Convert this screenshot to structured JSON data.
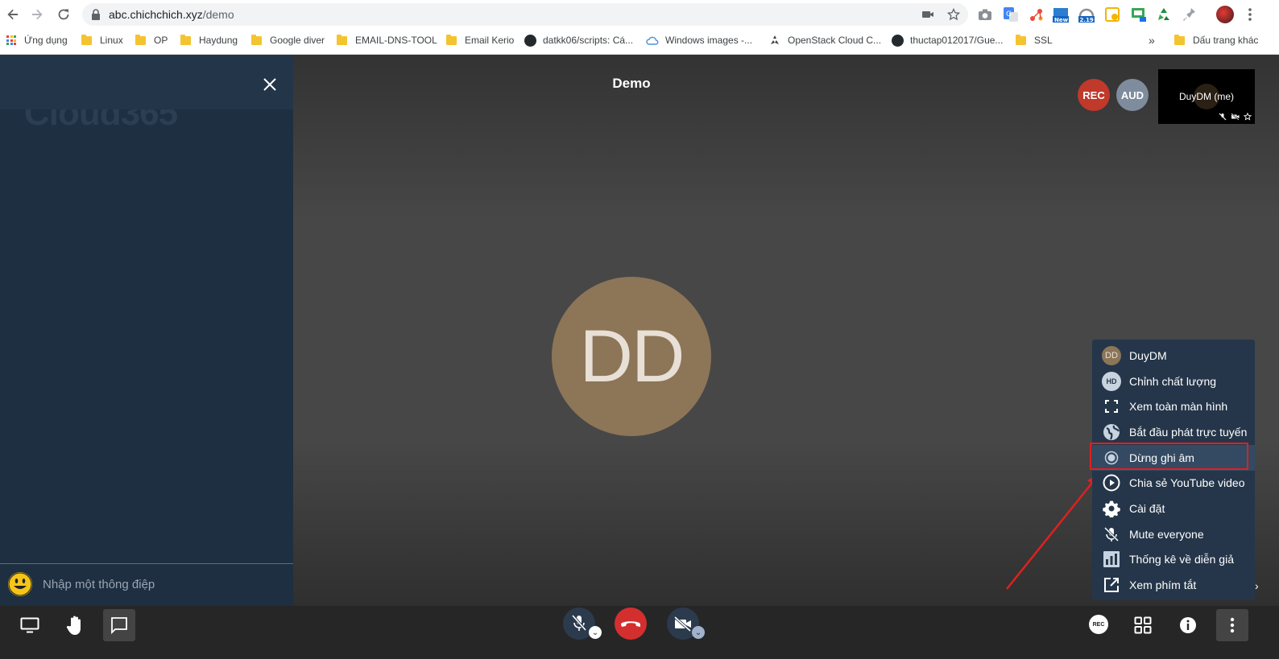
{
  "browser": {
    "url_host": "abc.chichchich.xyz",
    "url_path": "/demo",
    "bookmarks": [
      {
        "label": "Ứng dụng",
        "type": "apps"
      },
      {
        "label": "Linux",
        "type": "folder"
      },
      {
        "label": "OP",
        "type": "folder"
      },
      {
        "label": "Haydung",
        "type": "folder"
      },
      {
        "label": "Google diver",
        "type": "folder"
      },
      {
        "label": "EMAIL-DNS-TOOL",
        "type": "folder"
      },
      {
        "label": "Email Kerio",
        "type": "folder"
      },
      {
        "label": "datkk06/scripts: Cá...",
        "type": "github"
      },
      {
        "label": "Windows images -...",
        "type": "cloud"
      },
      {
        "label": "OpenStack Cloud C...",
        "type": "openstack"
      },
      {
        "label": "thuctap012017/Gue...",
        "type": "github"
      },
      {
        "label": "SSL",
        "type": "folder"
      },
      {
        "label": "Dấu trang khác",
        "type": "folder"
      }
    ],
    "overflow_label": "»"
  },
  "sidebar": {
    "watermark": "Cloud365",
    "chat_placeholder": "Nhập một thông điệp"
  },
  "meeting": {
    "title": "Demo",
    "rec_badge": "REC",
    "aud_badge": "AUD",
    "thumb_name": "DuyDM (me)",
    "avatar_initials": "DD"
  },
  "menu": {
    "items": [
      {
        "label": "DuyDM",
        "icon": "avatar-icon"
      },
      {
        "label": "Chỉnh chất lượng",
        "icon": "hd-icon"
      },
      {
        "label": "Xem toàn màn hình",
        "icon": "fullscreen-icon"
      },
      {
        "label": "Bắt đầu phát trực tuyến",
        "icon": "globe-icon"
      },
      {
        "label": "Dừng ghi âm",
        "icon": "record-icon"
      },
      {
        "label": "Chia sẻ YouTube video",
        "icon": "play-icon"
      },
      {
        "label": "Cài đặt",
        "icon": "gear-icon"
      },
      {
        "label": "Mute everyone",
        "icon": "mic-off-icon"
      },
      {
        "label": "Thống kê về diễn giả",
        "icon": "stats-icon"
      },
      {
        "label": "Xem phím tắt",
        "icon": "external-link-icon"
      }
    ],
    "avatar_initials": "DD",
    "hd_label": "HD"
  },
  "toolbar": {
    "rec_small": "REC"
  },
  "colors": {
    "rec": "#c0392b",
    "aud": "#7f8c9d",
    "hangup": "#d32f2f",
    "highlight_box": "#e02020"
  }
}
